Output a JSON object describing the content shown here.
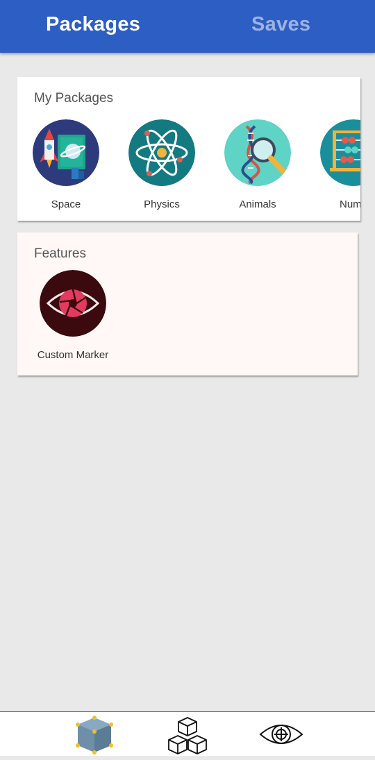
{
  "header": {
    "tabs": [
      {
        "label": "Packages",
        "active": true
      },
      {
        "label": "Saves",
        "active": false
      }
    ],
    "color": "#2c5ec4"
  },
  "my_packages": {
    "title": "My Packages",
    "items": [
      {
        "label": "Space",
        "icon": "space-rocket-planet-icon"
      },
      {
        "label": "Physics",
        "icon": "atom-icon"
      },
      {
        "label": "Animals",
        "icon": "dna-magnifier-icon"
      },
      {
        "label": "Numb",
        "icon": "abacus-icon"
      }
    ]
  },
  "features": {
    "title": "Features",
    "items": [
      {
        "label": "Custom Marker",
        "icon": "eye-aperture-icon"
      }
    ]
  },
  "bottom_nav": [
    {
      "icon": "cube-icon",
      "active": true
    },
    {
      "icon": "cubes-stack-icon",
      "active": false
    },
    {
      "icon": "eye-target-icon",
      "active": false
    }
  ]
}
